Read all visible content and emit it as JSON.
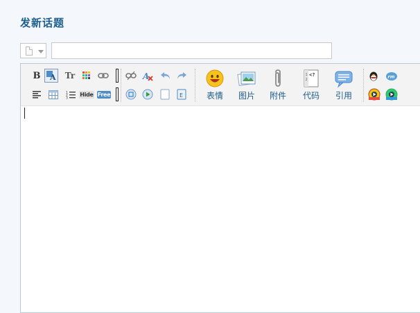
{
  "page": {
    "title": "发新话题"
  },
  "subject": {
    "value": "",
    "placeholder": ""
  },
  "editor": {
    "toolbar": {
      "row1": [
        "bold-button",
        "format-button",
        "font-size-button",
        "font-color-button",
        "link-button",
        "unlink-button",
        "remove-format-button",
        "undo-button",
        "redo-button"
      ],
      "row2": {
        "hide_label": "Hide",
        "free_label": "Free"
      },
      "large_buttons": [
        {
          "label": "表情",
          "icon": "smiley-icon"
        },
        {
          "label": "图片",
          "icon": "image-icon"
        },
        {
          "label": "附件",
          "icon": "paperclip-icon"
        },
        {
          "label": "代码",
          "icon": "code-icon"
        },
        {
          "label": "引用",
          "icon": "quote-icon"
        }
      ]
    },
    "content": ""
  }
}
